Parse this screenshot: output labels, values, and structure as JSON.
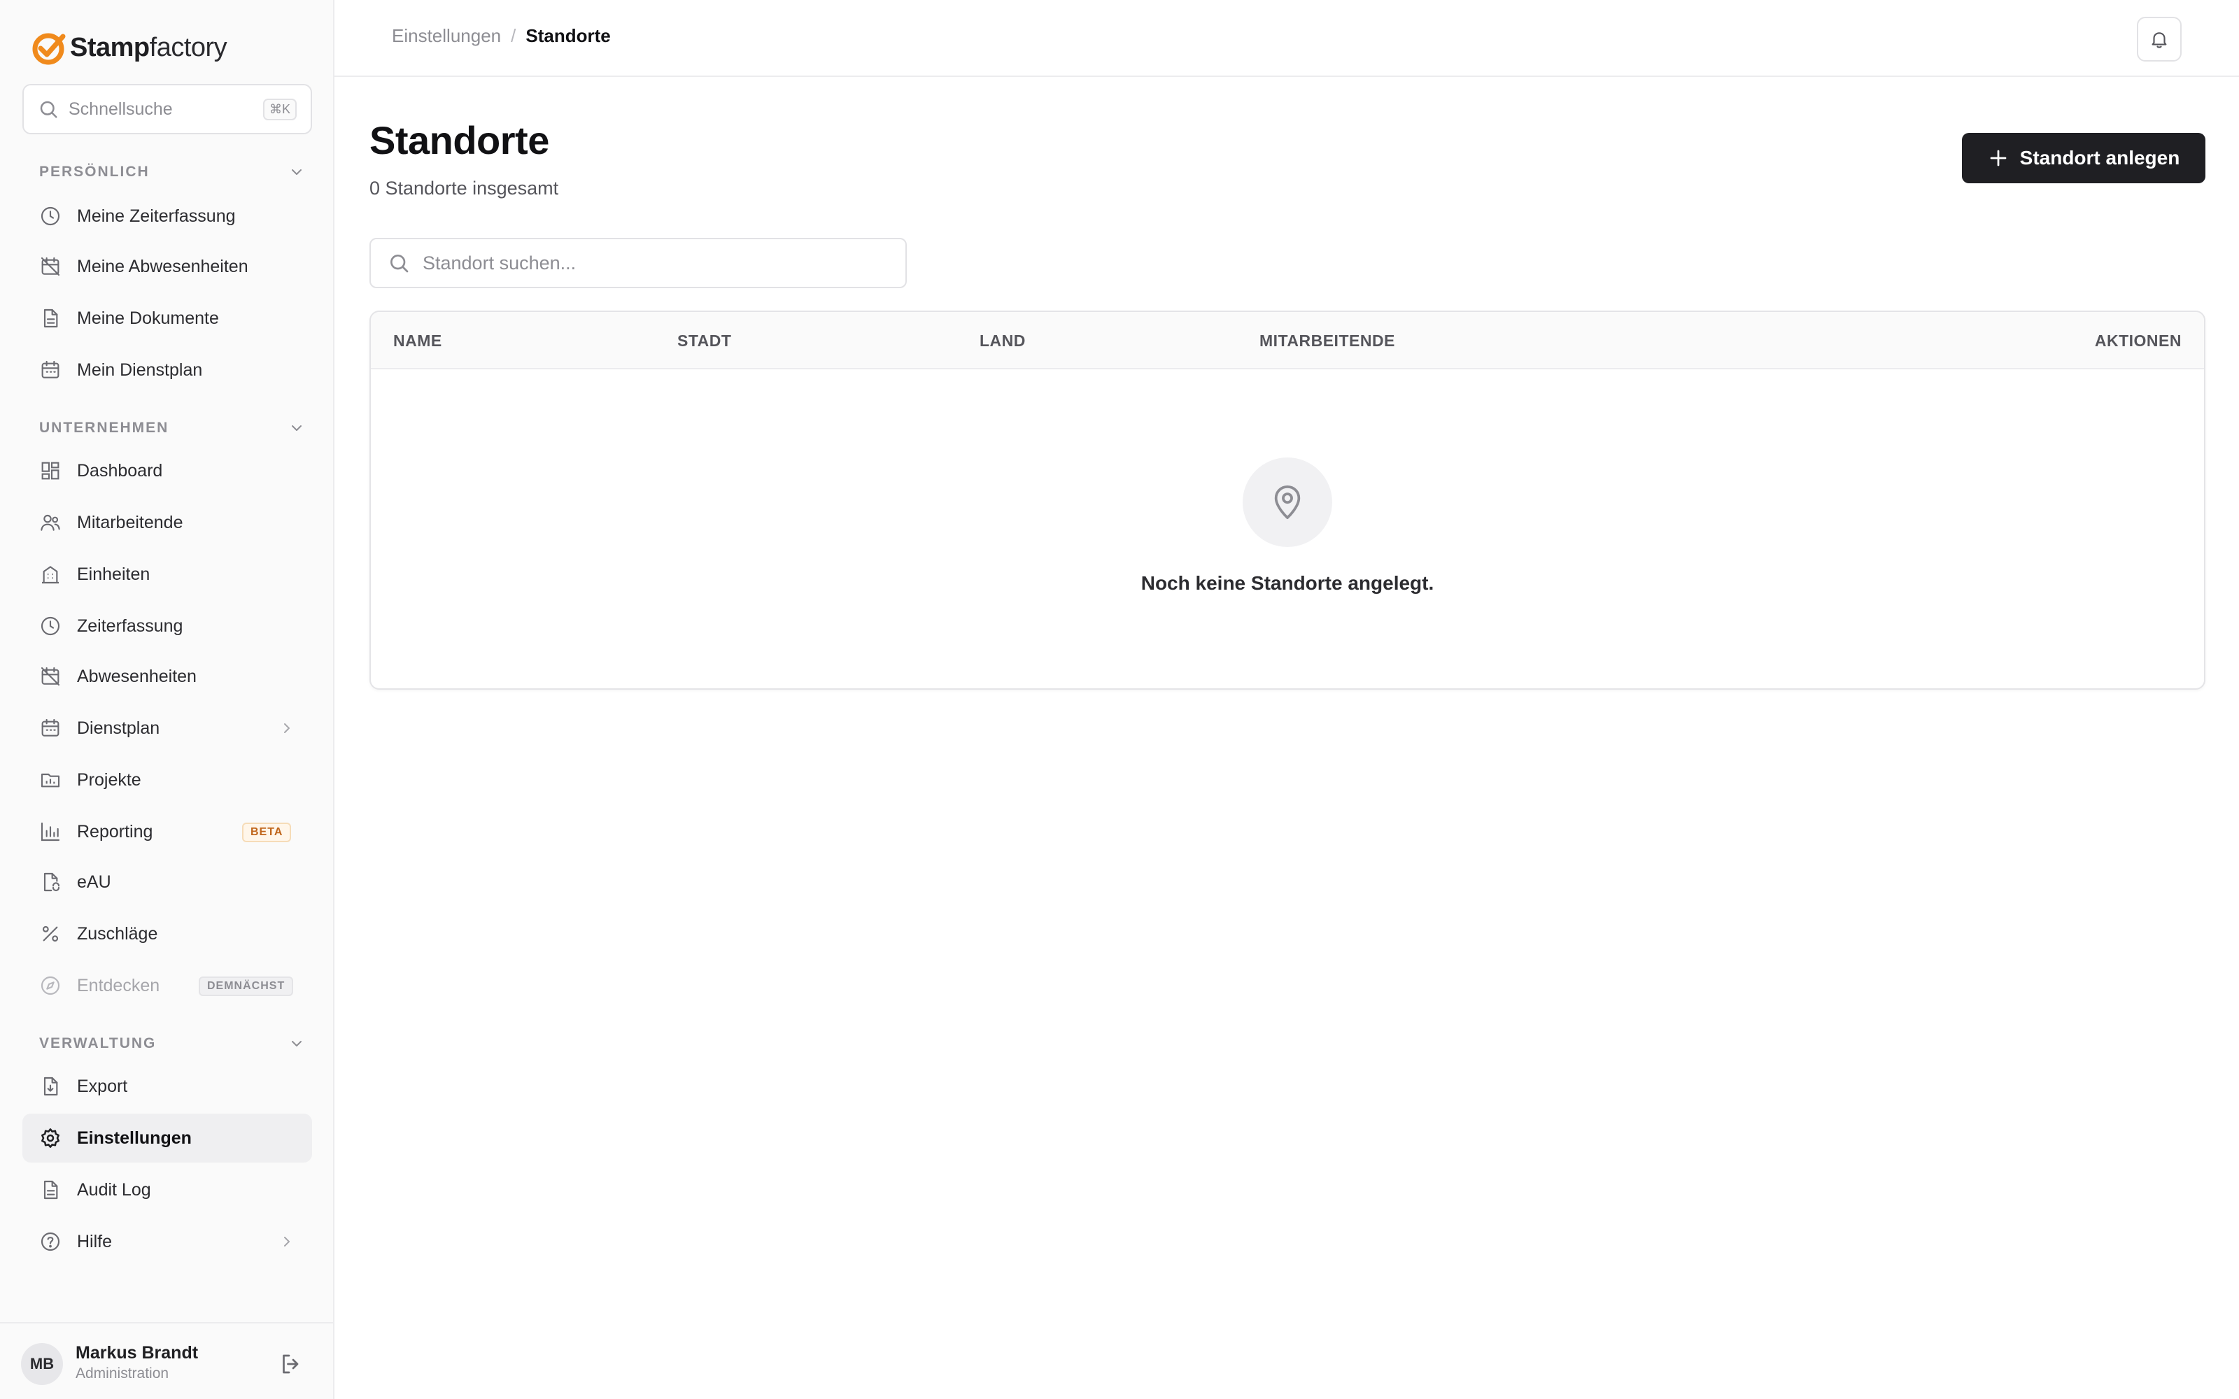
{
  "brand": {
    "name_part1": "Stamp",
    "name_part2": "factory",
    "logo_color": "#f08a1c"
  },
  "sidebar": {
    "search": {
      "placeholder": "Schnellsuche",
      "shortcut": "⌘K"
    },
    "sections": [
      {
        "title": "PERSÖNLICH",
        "items": [
          {
            "label": "Meine Zeiterfassung",
            "icon": "clock-icon"
          },
          {
            "label": "Meine Abwesenheiten",
            "icon": "calendar-off-icon"
          },
          {
            "label": "Meine Dokumente",
            "icon": "document-icon"
          },
          {
            "label": "Mein Dienstplan",
            "icon": "calendar-icon"
          }
        ]
      },
      {
        "title": "UNTERNEHMEN",
        "items": [
          {
            "label": "Dashboard",
            "icon": "dashboard-icon"
          },
          {
            "label": "Mitarbeitende",
            "icon": "users-icon"
          },
          {
            "label": "Einheiten",
            "icon": "building-icon"
          },
          {
            "label": "Zeiterfassung",
            "icon": "clock-icon"
          },
          {
            "label": "Abwesenheiten",
            "icon": "calendar-off-icon"
          },
          {
            "label": "Dienstplan",
            "icon": "calendar-icon"
          },
          {
            "label": "Projekte",
            "icon": "folder-chart-icon"
          },
          {
            "label": "Reporting",
            "icon": "bar-chart-icon",
            "badge": "BETA"
          },
          {
            "label": "eAU",
            "icon": "file-sync-icon"
          },
          {
            "label": "Zuschläge",
            "icon": "percent-icon"
          },
          {
            "label": "Entdecken",
            "icon": "compass-icon",
            "badge": "DEMNÄCHST"
          }
        ]
      },
      {
        "title": "VERWALTUNG",
        "items": [
          {
            "label": "Export",
            "icon": "file-export-icon"
          },
          {
            "label": "Einstellungen",
            "icon": "gear-icon",
            "active": true
          },
          {
            "label": "Audit Log",
            "icon": "document-icon"
          },
          {
            "label": "Hilfe",
            "icon": "help-icon"
          }
        ]
      }
    ]
  },
  "user": {
    "initials": "MB",
    "name": "Markus Brandt",
    "role": "Administration"
  },
  "topbar": {
    "breadcrumb": {
      "parent": "Einstellungen",
      "separator": "/",
      "current": "Standorte"
    }
  },
  "main": {
    "title": "Standorte",
    "subtitle": "0 Standorte insgesamt",
    "create_button": "Standort anlegen",
    "search_placeholder": "Standort suchen...",
    "table": {
      "columns": [
        "NAME",
        "STADT",
        "LAND",
        "MITARBEITENDE",
        "AKTIONEN"
      ],
      "rows": [],
      "empty_text": "Noch keine Standorte angelegt."
    }
  }
}
